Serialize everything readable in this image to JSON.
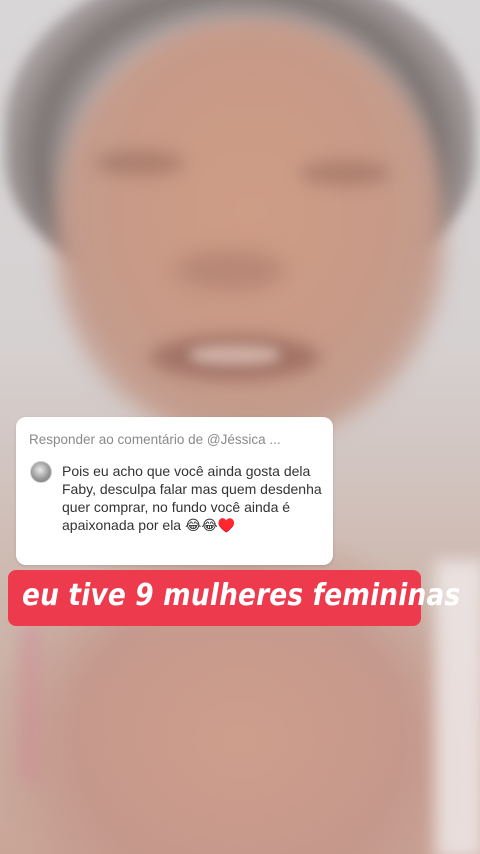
{
  "reply": {
    "header": "Responder ao comentário de @Jéssica ...",
    "comment_text": "Pois eu acho que você ainda gosta dela Faby,   desculpa falar mas quem desdenha quer comprar,  no fundo você ainda é apaixonada por ela 😂😂♥️"
  },
  "caption": {
    "text": "eu tive 9 mulheres femininas",
    "background_color": "#ee3a4d"
  },
  "icons": {
    "avatar": "user-avatar"
  }
}
